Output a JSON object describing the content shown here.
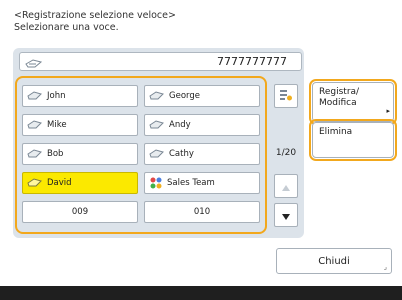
{
  "header": {
    "line1": "<Registrazione selezione veloce>",
    "line2": "Selezionare una voce."
  },
  "topbar": {
    "number": "7777777777",
    "icon": "address-book-icon"
  },
  "entries": [
    {
      "label": "John",
      "icon": "contact-icon"
    },
    {
      "label": "George",
      "icon": "contact-icon"
    },
    {
      "label": "Mike",
      "icon": "contact-icon"
    },
    {
      "label": "Andy",
      "icon": "contact-icon"
    },
    {
      "label": "Bob",
      "icon": "contact-icon"
    },
    {
      "label": "Cathy",
      "icon": "contact-icon"
    },
    {
      "label": "David",
      "icon": "contact-icon",
      "selected": true
    },
    {
      "label": "Sales Team",
      "icon": "group-icon"
    },
    {
      "label": "009",
      "icon": ""
    },
    {
      "label": "010",
      "icon": ""
    }
  ],
  "pager": {
    "page": "1/20",
    "up_icon": "arrow-up-icon",
    "down_icon": "arrow-down-icon",
    "detail_icon": "detail-icon"
  },
  "actions": {
    "register_line1": "Registra/",
    "register_line2": "Modifica",
    "delete": "Elimina"
  },
  "close_label": "Chiudi",
  "colors": {
    "highlight": "#f2a81d",
    "selected": "#fbe900",
    "panel": "#dce3ea"
  }
}
